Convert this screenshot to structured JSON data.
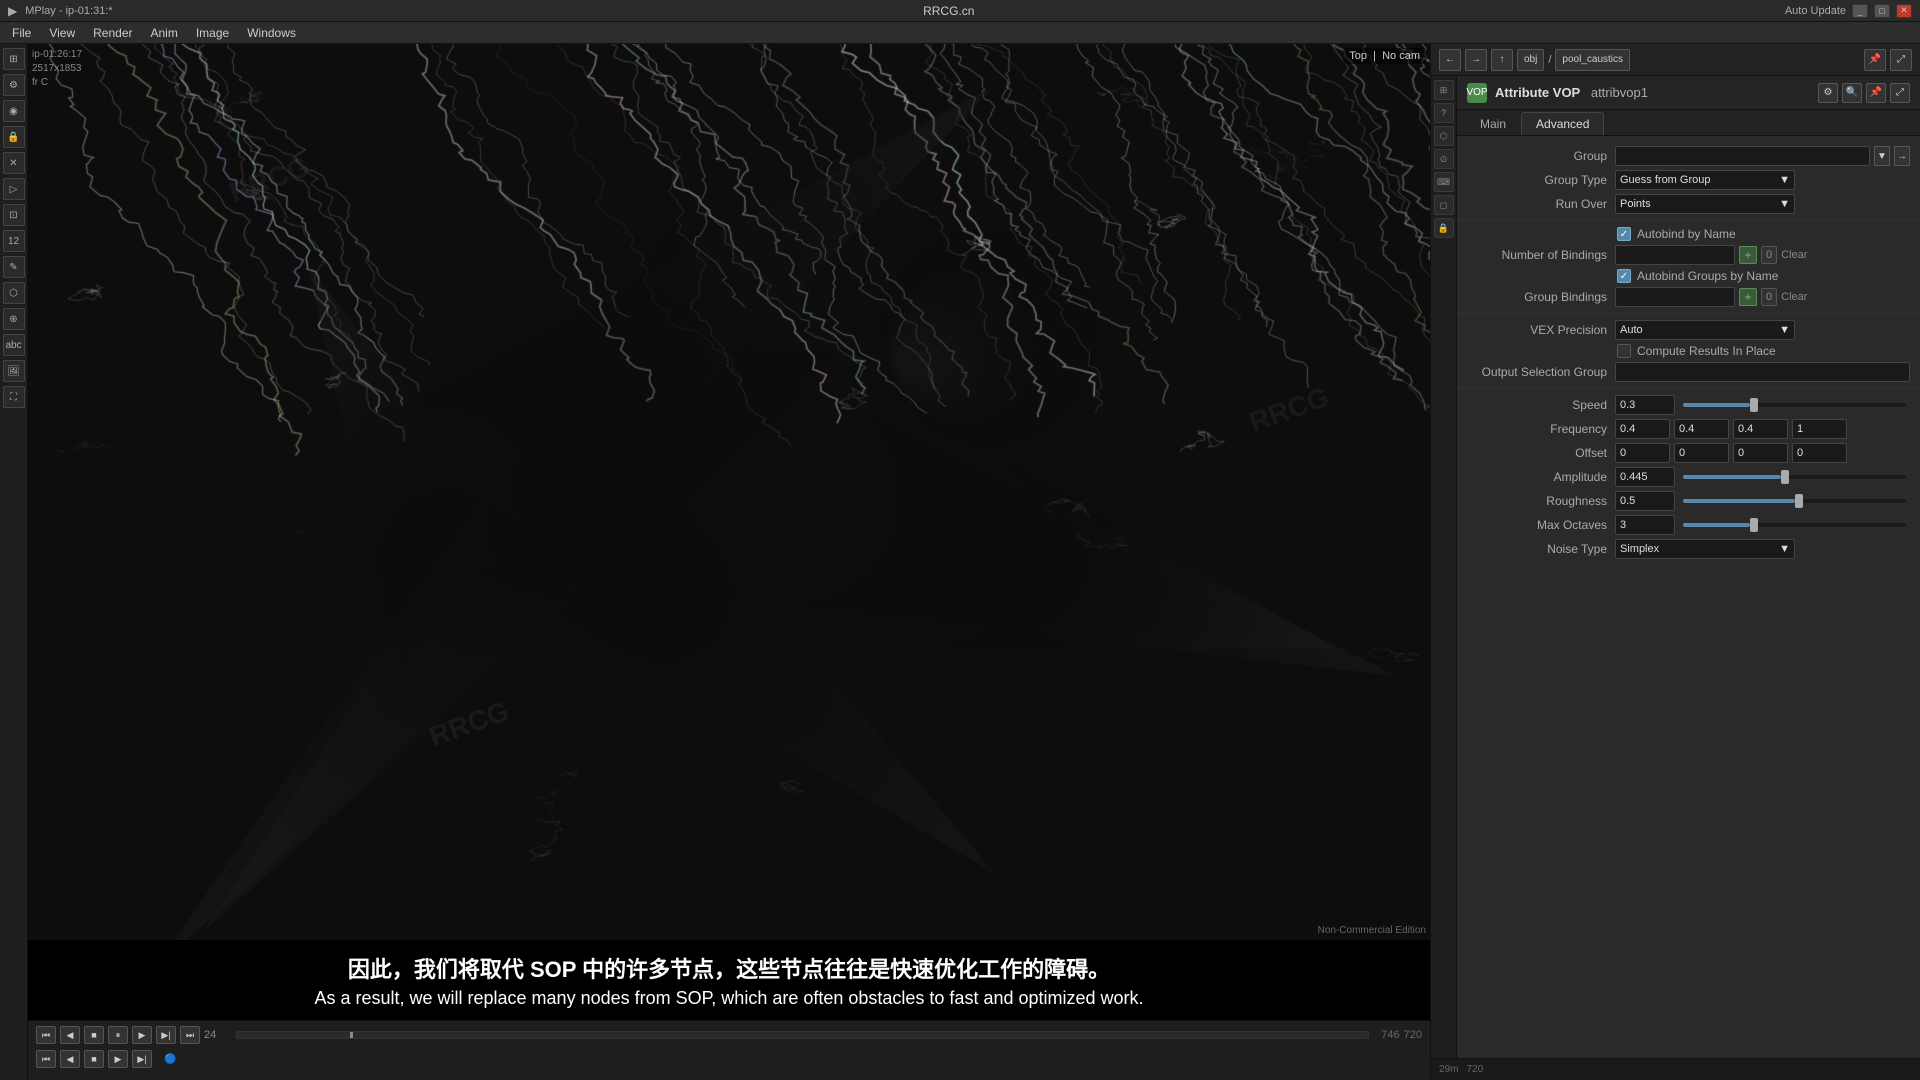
{
  "window": {
    "title": "MPlay - ip-01:31:*",
    "center_title": "RRCG.cn",
    "auto_update": "Auto Update"
  },
  "menu": {
    "items": [
      "File",
      "View",
      "Render",
      "Anim",
      "Image",
      "Windows"
    ]
  },
  "viewport": {
    "overlay_tl_line1": "ip-01:26:17",
    "overlay_tl_line2": "2517x1853",
    "overlay_tl_line3": "fr C",
    "top_badge": "Top",
    "cam_badge": "No cam",
    "br_text": "Non-Commercial Edition"
  },
  "right_toolbar": {
    "path_node1": "obj",
    "path_node2": "pool_caustics"
  },
  "node": {
    "label": "Attribute VOP",
    "name": "attribvop1",
    "icon": "VOP"
  },
  "tabs": {
    "main": "Main",
    "advanced": "Advanced"
  },
  "params": {
    "group_label": "Group",
    "group_value": "",
    "group_type_label": "Group Type",
    "group_type_value": "Guess from Group",
    "run_over_label": "Run Over",
    "run_over_value": "Points",
    "autobind_label": "Autobind by Name",
    "autobind_checked": true,
    "num_bindings_label": "Number of Bindings",
    "num_bindings_value": "0",
    "autobind_groups_label": "Autobind Groups by Name",
    "autobind_groups_checked": true,
    "group_bindings_label": "Group Bindings",
    "group_bindings_value": "0",
    "vex_precision_label": "VEX Precision",
    "vex_precision_value": "Auto",
    "compute_results_label": "Compute Results In Place",
    "compute_results_checked": false,
    "output_sel_group_label": "Output Selection Group",
    "output_sel_group_value": "",
    "speed_label": "Speed",
    "speed_value": "0.3",
    "speed_pct": 30,
    "freq_label": "Frequency",
    "freq_x": "0.4",
    "freq_y": "0.4",
    "freq_z": "0.4",
    "freq_w": "1",
    "offset_label": "Offset",
    "offset_x": "0",
    "offset_y": "0",
    "offset_z": "0",
    "offset_w": "0",
    "amplitude_label": "Amplitude",
    "amplitude_value": "0.445",
    "amplitude_pct": 44,
    "roughness_label": "Roughness",
    "roughness_value": "0.5",
    "roughness_pct": 50,
    "max_octaves_label": "Max Octaves",
    "max_octaves_value": "3",
    "max_octaves_pct": 30,
    "noise_type_label": "Noise Type",
    "noise_type_value": "Simplex"
  },
  "subtitle": {
    "cn": "因此，我们将取代 SOP 中的许多节点，这些节点往往是快速优化工作的障碍。",
    "en": "As a result, we will replace many nodes from SOP, which are often obstacles to fast and optimized work."
  },
  "transport": {
    "frame_label": "24",
    "time_code": "746",
    "fps": "720"
  },
  "status": {
    "text": "29m",
    "fps_text": "720"
  }
}
